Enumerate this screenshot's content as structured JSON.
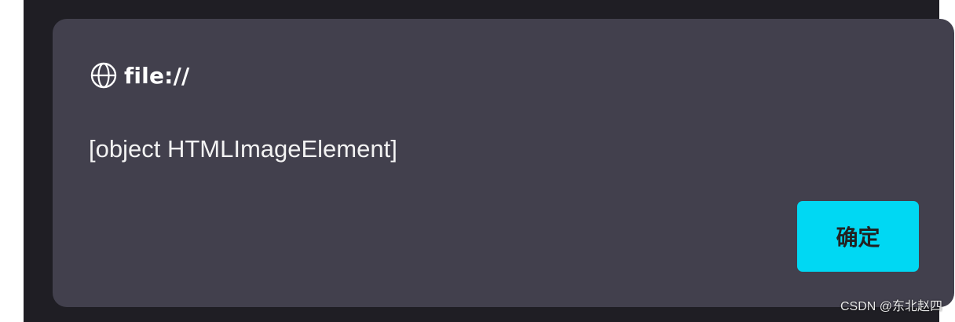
{
  "dialog": {
    "origin_icon": "globe-icon",
    "origin_text": "file://",
    "message": "[object HTMLImageElement]",
    "ok_label": "确定"
  },
  "watermark": "CSDN @东北赵四",
  "colors": {
    "backdrop": "#1f1e24",
    "dialog_bg": "#42404d",
    "button_bg": "#00d8f3",
    "text": "#ffffff"
  }
}
